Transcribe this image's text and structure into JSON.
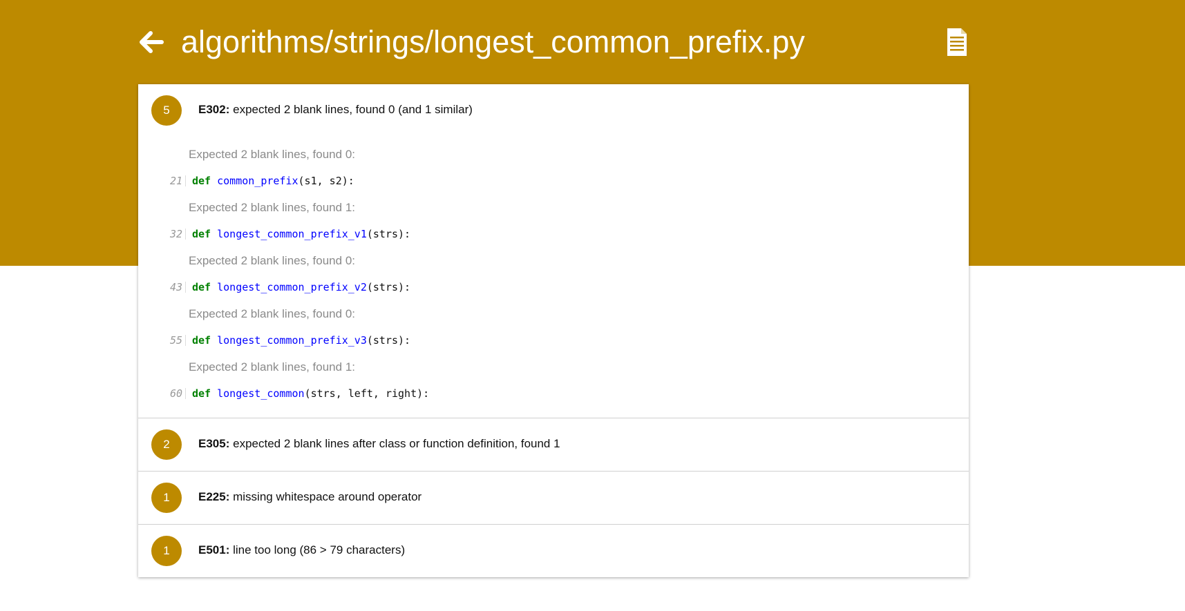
{
  "header": {
    "title": "algorithms/strings/longest_common_prefix.py",
    "back_icon": "arrow-left-icon",
    "file_icon": "document-icon"
  },
  "colors": {
    "accent": "#bd8a00",
    "keyword": "#008000",
    "function_name": "#0000ff",
    "muted_text": "#8a8a8a"
  },
  "issues": [
    {
      "count": "5",
      "code": "E302:",
      "message": "expected 2 blank lines, found 0 (and 1 similar)",
      "occurrences": [
        {
          "description": "Expected 2 blank lines, found 0:",
          "line": "21",
          "keyword": "def",
          "name": "common_prefix",
          "rest": "(s1, s2):"
        },
        {
          "description": "Expected 2 blank lines, found 1:",
          "line": "32",
          "keyword": "def",
          "name": "longest_common_prefix_v1",
          "rest": "(strs):"
        },
        {
          "description": "Expected 2 blank lines, found 0:",
          "line": "43",
          "keyword": "def",
          "name": "longest_common_prefix_v2",
          "rest": "(strs):"
        },
        {
          "description": "Expected 2 blank lines, found 0:",
          "line": "55",
          "keyword": "def",
          "name": "longest_common_prefix_v3",
          "rest": "(strs):"
        },
        {
          "description": "Expected 2 blank lines, found 1:",
          "line": "60",
          "keyword": "def",
          "name": "longest_common",
          "rest": "(strs, left, right):"
        }
      ]
    },
    {
      "count": "2",
      "code": "E305:",
      "message": "expected 2 blank lines after class or function definition, found 1"
    },
    {
      "count": "1",
      "code": "E225:",
      "message": "missing whitespace around operator"
    },
    {
      "count": "1",
      "code": "E501:",
      "message": "line too long (86 > 79 characters)"
    }
  ]
}
